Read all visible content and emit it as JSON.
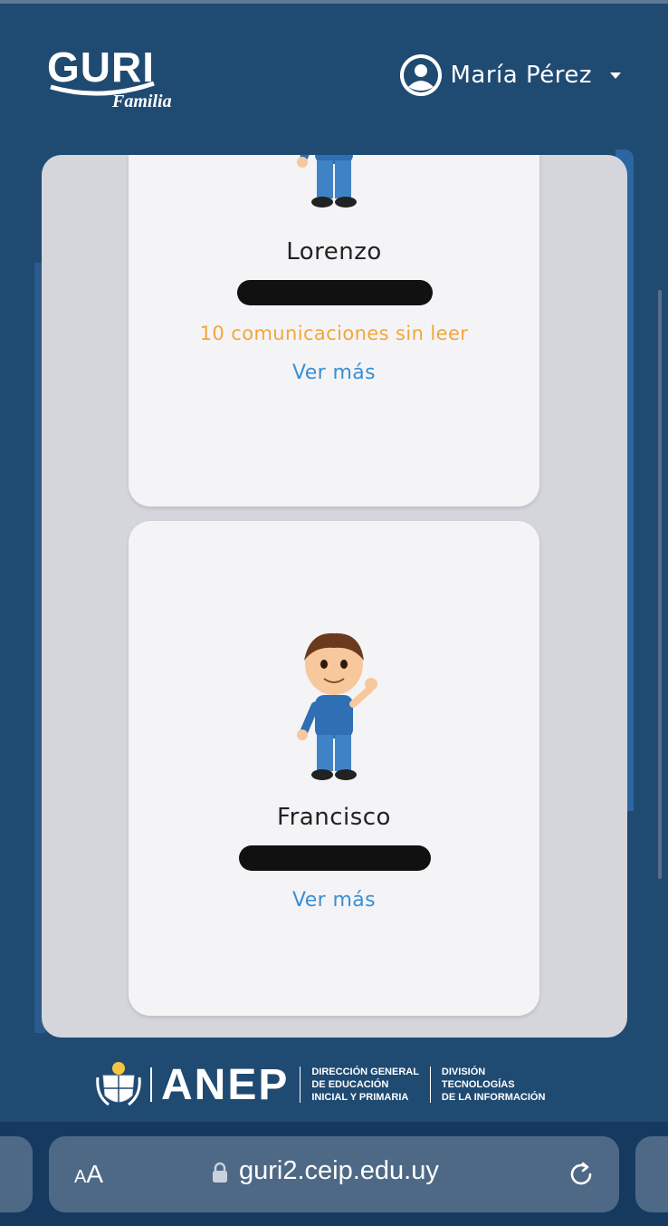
{
  "header": {
    "logo_text": "GURI",
    "logo_sub": "Familia",
    "user_name": "María Pérez"
  },
  "children": [
    {
      "name": "Lorenzo",
      "unread": "10 comunicaciones sin leer",
      "link": "Ver más"
    },
    {
      "name": "Francisco",
      "link": "Ver más"
    }
  ],
  "footer": {
    "org": "ANEP",
    "dept1": [
      "DIRECCIÓN GENERAL",
      "DE EDUCACIÓN",
      "INICIAL Y PRIMARIA"
    ],
    "dept2": [
      "DIVISIÓN",
      "TECNOLOGÍAS",
      "DE LA INFORMACIÓN"
    ]
  },
  "browser": {
    "text_size_small": "A",
    "text_size_big": "A",
    "url": "guri2.ceip.edu.uy"
  },
  "colors": {
    "background": "#1f4a72",
    "accent_link": "#3b8fd0",
    "unread": "#f2a63a"
  },
  "icons": [
    "user-avatar-icon",
    "caret-down-icon",
    "lock-icon",
    "reload-icon",
    "crest-icon"
  ]
}
